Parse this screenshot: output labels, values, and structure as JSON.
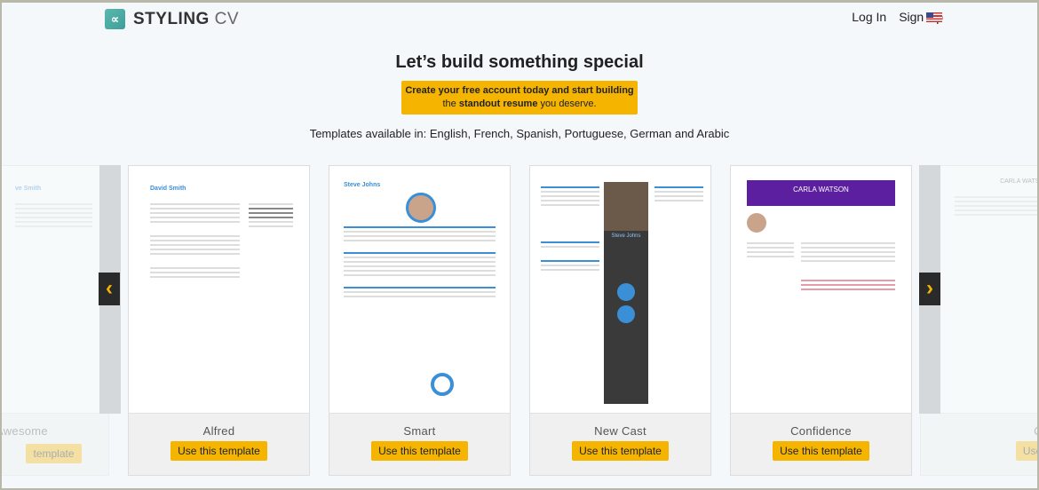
{
  "header": {
    "logo_icon": "infinity-check-logo",
    "brand_bold": "STYLING",
    "brand_light": "CV",
    "login": "Log In",
    "signup": "Sign Up",
    "flag": "us-flag-icon"
  },
  "hero": {
    "title": "Let’s build something special",
    "cta_line1": "Create your free account today and start building",
    "cta_line2_pre": "the ",
    "cta_line2_bold": "standout resume",
    "cta_line2_post": " you deserve.",
    "languages": "Templates available in: English, French, Spanish, Portuguese, German and Arabic"
  },
  "colors": {
    "accent": "#f5b400",
    "brand": "#4aaba4"
  },
  "templates": [
    {
      "name": "Awesome",
      "name_visible": "esome",
      "button": "template",
      "resume_name": "ve Smith"
    },
    {
      "name": "Alfred",
      "button": "Use this template",
      "resume_name": "David Smith"
    },
    {
      "name": "Smart",
      "button": "Use this template",
      "resume_name": "Steve Johns"
    },
    {
      "name": "New Cast",
      "button": "Use this template",
      "resume_name": "Steve Johns"
    },
    {
      "name": "Confidence",
      "button": "Use this template",
      "resume_name": "CARLA WATSON"
    },
    {
      "name": "Cors",
      "button": "Use this",
      "resume_name": "CARLA WATSON"
    }
  ],
  "carousel": {
    "prev": "‹",
    "next": "›"
  }
}
